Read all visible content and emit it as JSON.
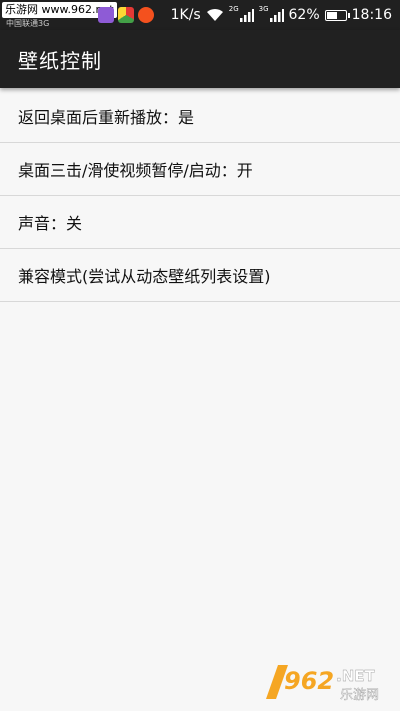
{
  "status_bar": {
    "watermark_text": "乐游网 www.962.net",
    "carrier": "中国联通3G",
    "notification_icons": [
      "purple-app-icon",
      "chrome-like-icon",
      "weibo-icon"
    ],
    "speed": "1K/s",
    "network_labels": [
      "2G",
      "3G"
    ],
    "battery_percent": "62%",
    "battery_level": 0.62,
    "time": "18:16"
  },
  "app_bar": {
    "title": "壁纸控制"
  },
  "settings": [
    {
      "label": "返回桌面后重新播放：是"
    },
    {
      "label": "桌面三击/滑使视频暂停/启动：开"
    },
    {
      "label": "声音：关"
    },
    {
      "label": "兼容模式(尝试从动态壁纸列表设置)"
    }
  ],
  "watermark_logo": {
    "number": "962",
    "suffix": ".NET",
    "name": "乐游网"
  },
  "colors": {
    "status_bar": "#202020",
    "app_bar": "#212121",
    "background": "#f7f7f7",
    "divider": "#d8d8d8"
  }
}
